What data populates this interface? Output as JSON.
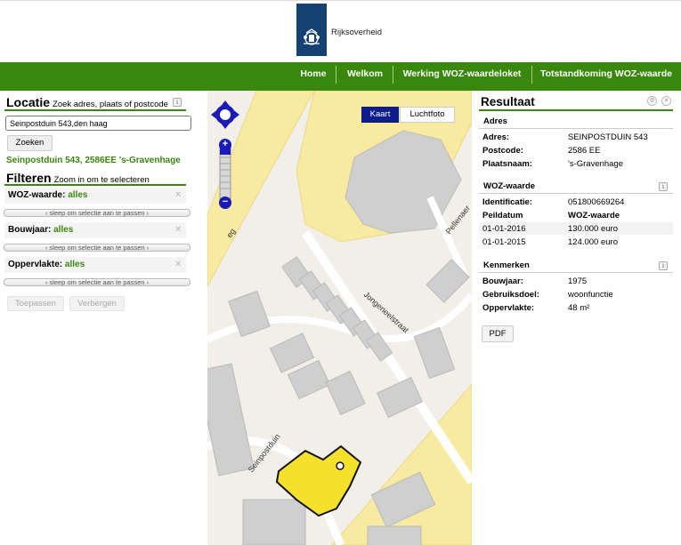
{
  "header": {
    "logo_text": "Rijksoverheid"
  },
  "nav": {
    "items": [
      "Home",
      "Welkom",
      "Werking WOZ-waardeloket",
      "Totstandkoming WOZ-waarde"
    ]
  },
  "locatie": {
    "title": "Locatie",
    "subtitle": "Zoek adres, plaats of postcode",
    "search_value": "Seinpostduin 543,den haag",
    "search_button": "Zoeken",
    "result_address": "Seinpostduin 543, 2586EE 's-Gravenhage",
    "info_icon": "i"
  },
  "filteren": {
    "title": "Filteren",
    "subtitle": "Zoom in om te selecteren",
    "filters": [
      {
        "label": "WOZ-waarde:",
        "value": "alles",
        "slider": "‹ sleep om selectie aan te passen ›"
      },
      {
        "label": "Bouwjaar:",
        "value": "alles",
        "slider": "‹ sleep om selectie aan te passen ›"
      },
      {
        "label": "Oppervlakte:",
        "value": "alles",
        "slider": "‹ sleep om selectie aan te passen ›"
      }
    ],
    "apply_button": "Toepassen",
    "hide_button": "Verbergen"
  },
  "map": {
    "toggle_map": "Kaart",
    "toggle_aerial": "Luchtfoto",
    "zoom_in": "+",
    "zoom_out": "−",
    "streets": [
      "Jongeneelstraat",
      "Seinpostduin",
      "Pellenaer",
      "eg"
    ],
    "colors": {
      "highlight": "#f5e12a",
      "road": "#f8eaa0",
      "building": "#cfcfcf",
      "land": "#f2efe8",
      "nav_control": "#1a1ab8"
    }
  },
  "resultaat": {
    "title": "Resultaat",
    "adres": {
      "heading": "Adres",
      "rows": [
        {
          "label": "Adres:",
          "value": "SEINPOSTDUIN 543"
        },
        {
          "label": "Postcode:",
          "value": "2586 EE"
        },
        {
          "label": "Plaatsnaam:",
          "value": "'s-Gravenhage"
        }
      ]
    },
    "woz": {
      "heading": "WOZ-waarde",
      "id_label": "Identificatie:",
      "id_value": "051800669264",
      "col_date": "Peildatum",
      "col_value": "WOZ-waarde",
      "rows": [
        {
          "date": "01-01-2016",
          "value": "130.000 euro"
        },
        {
          "date": "01-01-2015",
          "value": "124.000 euro"
        }
      ]
    },
    "kenmerken": {
      "heading": "Kenmerken",
      "rows": [
        {
          "label": "Bouwjaar:",
          "value": "1975"
        },
        {
          "label": "Gebruiksdoel:",
          "value": "woonfunctie"
        },
        {
          "label": "Oppervlakte:",
          "value": "48 m²"
        }
      ]
    },
    "pdf_button": "PDF"
  }
}
